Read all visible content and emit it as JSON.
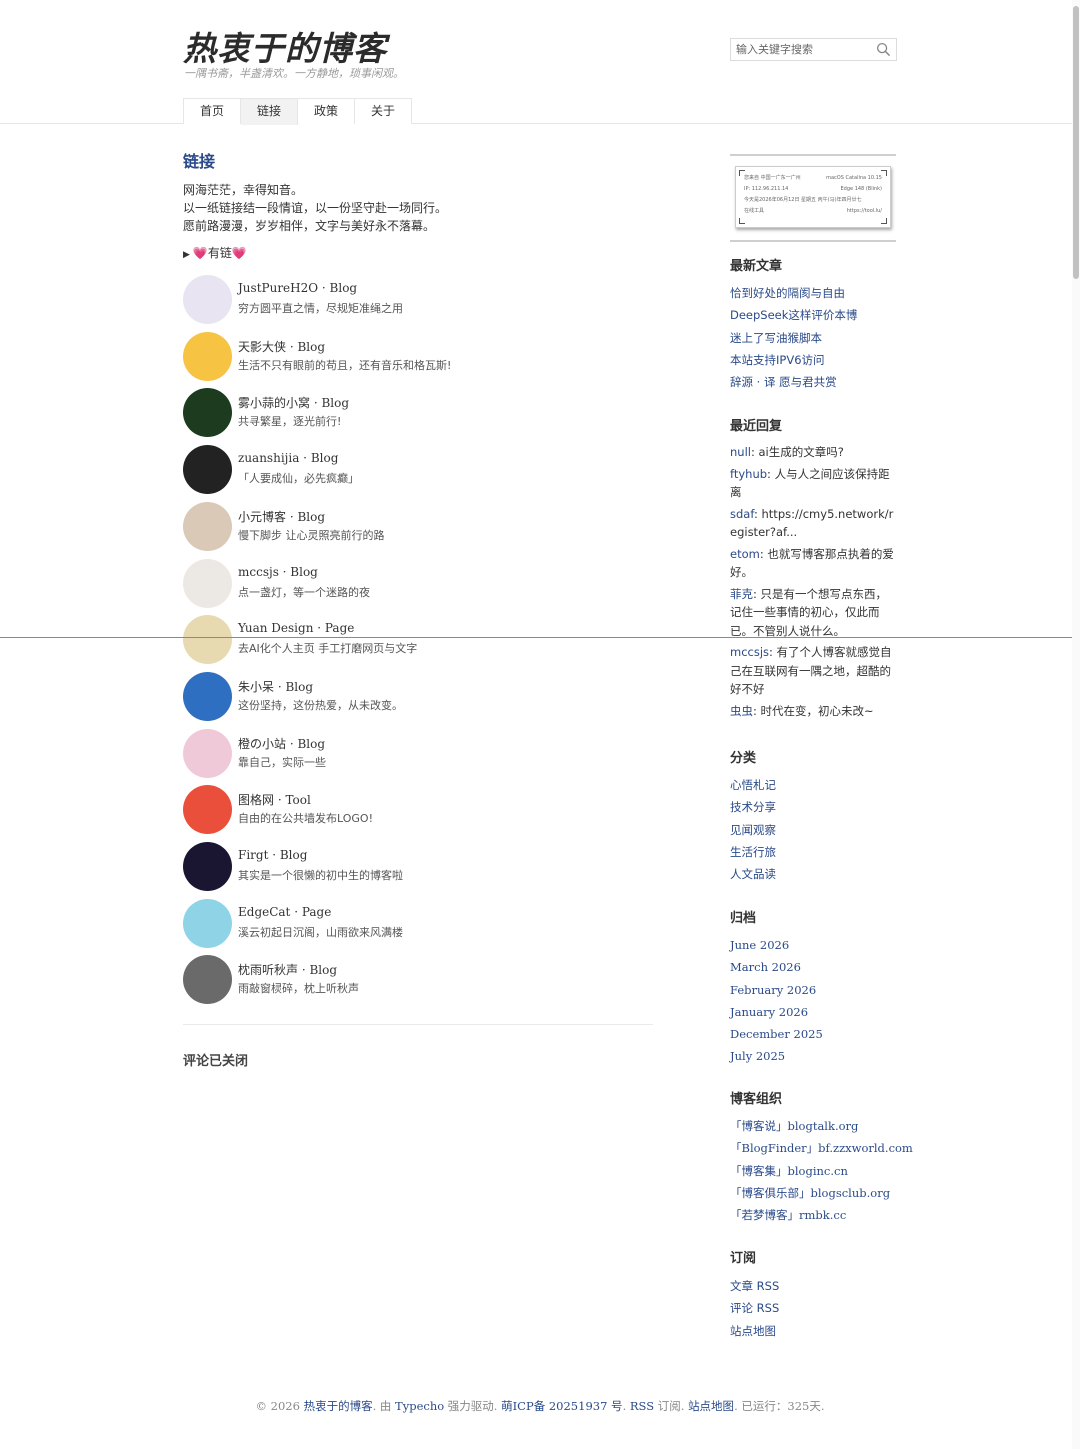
{
  "site": {
    "title": "热衷于的博客",
    "description": "一隅书斋，半盏清欢。一方静地，琐事闲观。"
  },
  "search": {
    "placeholder": "输入关键字搜索"
  },
  "nav": [
    {
      "label": "首页",
      "active": false
    },
    {
      "label": "链接",
      "active": true
    },
    {
      "label": "政策",
      "active": false
    },
    {
      "label": "关于",
      "active": false
    }
  ],
  "page": {
    "title": "链接",
    "intro": [
      "网海茫茫，幸得知音。",
      "以一纸链接结一段情谊，以一份坚守赴一场同行。",
      "愿前路漫漫，岁岁相伴，文字与美好永不落幕。"
    ],
    "details_heart_left": "💗",
    "details_label": "有链",
    "details_heart_right": "💗"
  },
  "friends": [
    {
      "name": "JustPureH2O · Blog",
      "desc": "穷方圆平直之情，尽规矩准绳之用",
      "avatar_color": "#e8e4f2"
    },
    {
      "name": "天影大侠 · Blog",
      "desc": "生活不只有眼前的苟且，还有音乐和格瓦斯!",
      "avatar_color": "#f6c342"
    },
    {
      "name": "雾小蒜的小窝 · Blog",
      "desc": "共寻繁星，逐光前行!",
      "avatar_color": "#1c3b1f"
    },
    {
      "name": "zuanshijia · Blog",
      "desc": "「人要成仙，必先疯癫」",
      "avatar_color": "#222222"
    },
    {
      "name": "小元博客 · Blog",
      "desc": "慢下脚步 让心灵照亮前行的路",
      "avatar_color": "#d9c9b6"
    },
    {
      "name": "mccsjs · Blog",
      "desc": "点一盏灯，等一个迷路的夜",
      "avatar_color": "#ece9e4"
    },
    {
      "name": "Yuan Design · Page",
      "desc": "去AI化个人主页 手工打磨网页与文字",
      "avatar_color": "#e7d9b0"
    },
    {
      "name": "朱小呆 · Blog",
      "desc": "这份坚持，这份热爱，从未改变。",
      "avatar_color": "#2f6fc1"
    },
    {
      "name": "橙の小站 · Blog",
      "desc": "靠自己，实际一些",
      "avatar_color": "#f0c9d8"
    },
    {
      "name": "图格网 · Tool",
      "desc": "自由的在公共墙发布LOGO!",
      "avatar_color": "#e94f3a"
    },
    {
      "name": "Firgt · Blog",
      "desc": "其实是一个很懒的初中生的博客啦",
      "avatar_color": "#1a1530"
    },
    {
      "name": "EdgeCat · Page",
      "desc": "溪云初起日沉阁，山雨欲来风满楼",
      "avatar_color": "#8fd3e6"
    },
    {
      "name": "枕雨听秋声 · Blog",
      "desc": "雨敲窗棂碎，枕上听秋声",
      "avatar_color": "#6a6a6a"
    }
  ],
  "comments_closed": "评论已关闭",
  "ip_card": {
    "line1_left": "您来自 中国一广东一广州",
    "line1_right": "macOS Catalina 10.15",
    "line2_left": "IP: 112.96.211.14",
    "line2_right": "Edge 148 (Blink)",
    "line3": "今天是2026年06月12日 星期五 丙午(马)年四月廿七",
    "line4_left": "在线工具",
    "line4_right": "https://tool.lu/"
  },
  "sidebar": {
    "recent_posts_title": "最新文章",
    "recent_posts": [
      "恰到好处的隔阂与自由",
      "DeepSeek这样评价本博",
      "迷上了写油猴脚本",
      "本站支持IPV6访问",
      "辞源 · 译 愿与君共赏"
    ],
    "recent_replies_title": "最近回复",
    "recent_replies": [
      {
        "author": "null",
        "text": ": ai生成的文章吗?"
      },
      {
        "author": "ftyhub",
        "text": ": 人与人之间应该保持距离"
      },
      {
        "author": "sdaf",
        "text": ": https://cmy5.network/register?af..."
      },
      {
        "author": "etom",
        "text": ": 也就写博客那点执着的爱好。"
      },
      {
        "author": "菲克",
        "text": ": 只是有一个想写点东西，记住一些事情的初心，仅此而已。不管别人说什么。"
      },
      {
        "author": "mccsjs",
        "text": ": 有了个人博客就感觉自己在互联网有一隅之地，超酷的好不好"
      },
      {
        "author": "虫虫",
        "text": ": 时代在变，初心未改~"
      }
    ],
    "categories_title": "分类",
    "categories": [
      "心悟札记",
      "技术分享",
      "见闻观察",
      "生活行旅",
      "人文品读"
    ],
    "archives_title": "归档",
    "archives": [
      "June 2026",
      "March 2026",
      "February 2026",
      "January 2026",
      "December 2025",
      "July 2025"
    ],
    "orgs_title": "博客组织",
    "orgs": [
      "「博客说」blogtalk.org",
      "「BlogFinder」bf.zzxworld.com",
      "「博客集」bloginc.cn",
      "「博客俱乐部」blogsclub.org",
      "「若梦博客」rmbk.cc"
    ],
    "subscribe_title": "订阅",
    "subscribe": [
      "文章 RSS",
      "评论 RSS",
      "站点地图"
    ]
  },
  "footer": {
    "copyright": "© 2026 ",
    "site_link": "热衷于的博客",
    "powered_pre": ". 由 ",
    "typecho": "Typecho",
    "powered_post": " 强力驱动. ",
    "icp": "萌ICP备 20251937 号",
    "sep1": ". ",
    "rss": "RSS",
    "rss_post": " 订阅. ",
    "sitemap": "站点地图",
    "running": ". 已运行：325天."
  }
}
